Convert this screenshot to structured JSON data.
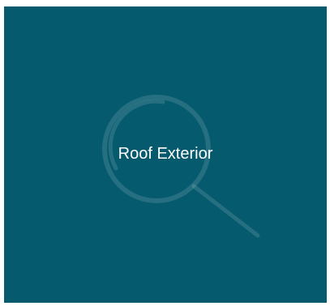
{
  "tile": {
    "label": "Roof Exterior",
    "icon": "magnifier-icon",
    "background_color": "#055a6e",
    "text_color": "#ffffff"
  }
}
